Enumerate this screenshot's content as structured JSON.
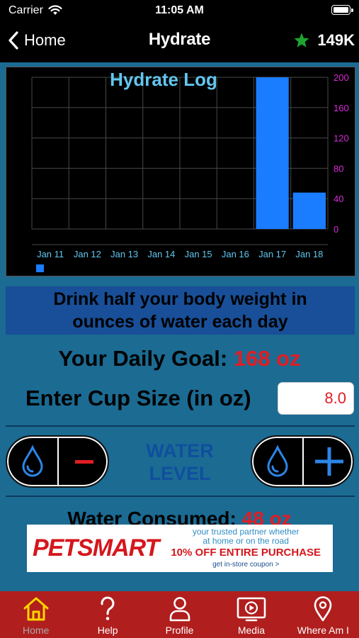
{
  "status_bar": {
    "carrier": "Carrier",
    "time": "11:05 AM"
  },
  "nav": {
    "back_label": "Home",
    "title": "Hydrate",
    "score": "149K",
    "star_color": "#1fa32f"
  },
  "chart_data": {
    "type": "bar",
    "title": "Hydrate Log",
    "categories": [
      "Jan 11",
      "Jan 12",
      "Jan 13",
      "Jan 14",
      "Jan 15",
      "Jan 16",
      "Jan 17",
      "Jan 18"
    ],
    "values": [
      0,
      0,
      0,
      0,
      0,
      0,
      200,
      48
    ],
    "ylim": [
      0,
      200
    ],
    "yticks": [
      0,
      40,
      80,
      120,
      160,
      200
    ],
    "grid": true,
    "bar_color": "#1a7cff",
    "ytick_color": "#d62bd6",
    "xtick_color": "#62c6ef",
    "legend_placement": "bottom-left"
  },
  "tip": {
    "line1": "Drink half your body weight in",
    "line2": "ounces of water each day"
  },
  "goal": {
    "label": "Your Daily Goal:",
    "value": "168 oz"
  },
  "cup": {
    "label": "Enter Cup Size (in oz)",
    "value": "8.0"
  },
  "water_level": {
    "line1": "WATER",
    "line2": "LEVEL"
  },
  "consumed": {
    "label": "Water Consumed:",
    "value": "48 oz"
  },
  "ad": {
    "brand": "PETSMART",
    "line1": "your trusted partner whether",
    "line2": "at home or on the road",
    "offer": "10% OFF ENTIRE PURCHASE",
    "coupon": "get in-store coupon >"
  },
  "tabs": [
    {
      "label": "Home",
      "icon": "home-icon"
    },
    {
      "label": "Help",
      "icon": "question-icon"
    },
    {
      "label": "Profile",
      "icon": "person-icon"
    },
    {
      "label": "Media",
      "icon": "media-icon"
    },
    {
      "label": "Where Am I",
      "icon": "location-pin-icon"
    }
  ],
  "colors": {
    "accent_red": "#e01e24",
    "background": "#1b6b93",
    "tab_bar": "#b01e1e",
    "tab_icon": "#ffd400"
  }
}
